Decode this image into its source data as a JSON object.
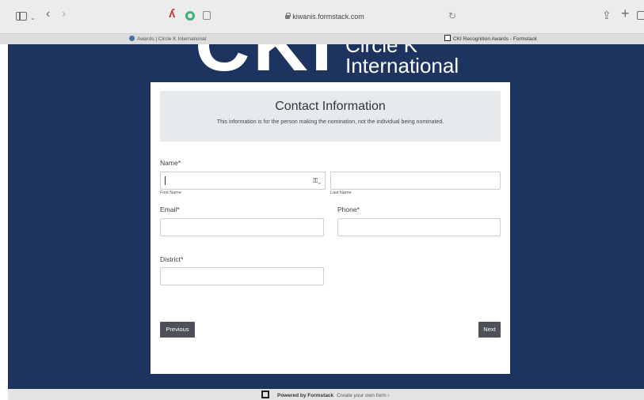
{
  "browser": {
    "address": "kiwanis.formstack.com",
    "tabs": [
      {
        "label": "Awards | Circle K International"
      },
      {
        "label": "CKI Recognition Awards - Formstack"
      }
    ],
    "icons": {
      "sidebar": "sidebar-icon",
      "back": "‹",
      "forward": "›",
      "share": "⇪",
      "new_tab": "+",
      "reload": "↻"
    }
  },
  "logo": {
    "mark": "CKI",
    "line1": "Circle K",
    "line2": "International"
  },
  "form": {
    "title": "Contact Information",
    "subtitle": "This information is for the person making the nomination, not the individual being nominated.",
    "name": {
      "label": "Name",
      "required_mark": "*",
      "first_sub": "First Name",
      "last_sub": "Last Name",
      "first_value": "",
      "last_value": ""
    },
    "email": {
      "label": "Email",
      "required_mark": "*",
      "value": ""
    },
    "phone": {
      "label": "Phone",
      "required_mark": "*",
      "value": ""
    },
    "district": {
      "label": "District",
      "required_mark": "*",
      "value": ""
    },
    "previous_label": "Previous",
    "next_label": "Next"
  },
  "footer": {
    "powered": "Powered by Formstack",
    "create": "Create your own form ›"
  },
  "colors": {
    "page_bg": "#1d3461",
    "header_bg": "#e6eaed",
    "button_bg": "#4d5157"
  }
}
